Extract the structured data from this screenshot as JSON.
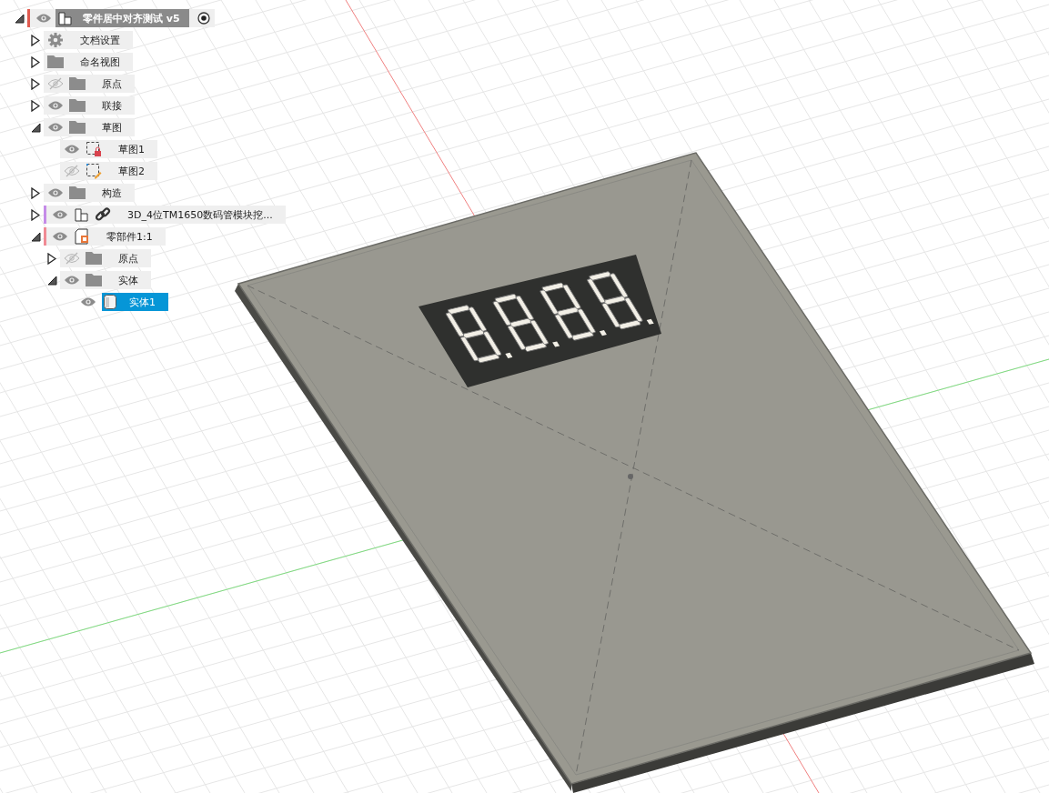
{
  "browser": {
    "root": {
      "label": "零件居中对齐测试 v5",
      "active": true,
      "expanded": true,
      "visible": true,
      "kind": "component",
      "color": "#e05a4f",
      "selected": false,
      "children": [
        {
          "label": "文档设置",
          "expanded": false,
          "kind": "gear",
          "selected": false
        },
        {
          "label": "命名视图",
          "expanded": false,
          "kind": "folder",
          "selected": false
        },
        {
          "label": "原点",
          "expanded": false,
          "visible": false,
          "kind": "folder",
          "selected": false
        },
        {
          "label": "联接",
          "expanded": false,
          "visible": true,
          "kind": "folder",
          "selected": false
        },
        {
          "label": "草图",
          "expanded": true,
          "visible": true,
          "kind": "folder",
          "selected": false,
          "children": [
            {
              "label": "草图1",
              "visible": true,
              "kind": "sketchlocked",
              "selected": false
            },
            {
              "label": "草图2",
              "visible": false,
              "kind": "sketch",
              "selected": false
            }
          ]
        },
        {
          "label": "构造",
          "expanded": false,
          "visible": true,
          "kind": "folder",
          "selected": false
        },
        {
          "label": "3D_4位TM1650数码管模块挖...",
          "expanded": false,
          "visible": true,
          "kind": "linked",
          "color": "#c58be8",
          "selected": false
        },
        {
          "label": "零部件1:1",
          "expanded": true,
          "visible": true,
          "kind": "pinned",
          "color": "#f08a94",
          "selected": false,
          "children": [
            {
              "label": "原点",
              "expanded": false,
              "visible": false,
              "kind": "folder",
              "selected": false
            },
            {
              "label": "实体",
              "expanded": true,
              "visible": true,
              "kind": "folder",
              "selected": false,
              "children": [
                {
                  "label": "实体1",
                  "visible": true,
                  "kind": "body",
                  "selected": true
                }
              ]
            }
          ]
        }
      ]
    }
  }
}
